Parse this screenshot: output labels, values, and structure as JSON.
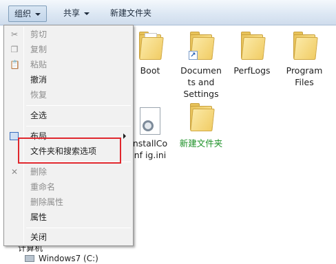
{
  "toolbar": {
    "organize_label": "组织",
    "share_label": "共享",
    "new_folder_label": "新建文件夹"
  },
  "menu": {
    "items": [
      {
        "label": "剪切",
        "enabled": false,
        "icon": "scissors-icon"
      },
      {
        "label": "复制",
        "enabled": false,
        "icon": "copy-icon"
      },
      {
        "label": "粘贴",
        "enabled": false,
        "icon": "paste-icon"
      },
      {
        "label": "撤消",
        "enabled": true
      },
      {
        "label": "恢复",
        "enabled": false
      },
      {
        "label": "全选",
        "enabled": true
      },
      {
        "label": "布局",
        "enabled": true,
        "icon": "layout-icon",
        "submenu": true
      },
      {
        "label": "文件夹和搜索选项",
        "enabled": true,
        "highlighted": true
      },
      {
        "label": "删除",
        "enabled": false,
        "icon": "delete-icon"
      },
      {
        "label": "重命名",
        "enabled": false
      },
      {
        "label": "删除属性",
        "enabled": false
      },
      {
        "label": "属性",
        "enabled": true
      },
      {
        "label": "关闭",
        "enabled": true
      }
    ]
  },
  "files": [
    {
      "label": "Boot",
      "type": "folder"
    },
    {
      "label": "Documents and Settings",
      "type": "folder-shortcut"
    },
    {
      "label": "PerfLogs",
      "type": "folder"
    },
    {
      "label": "Program Files",
      "type": "folder"
    },
    {
      "label": "installConfig.ini",
      "type": "file",
      "display": "nstallConf ig.ini"
    },
    {
      "label": "新建文件夹",
      "type": "folder",
      "color": "#1a8f24"
    }
  ],
  "nav": {
    "partial_label": "计算机",
    "drive_label": "Windows7 (C:)"
  }
}
